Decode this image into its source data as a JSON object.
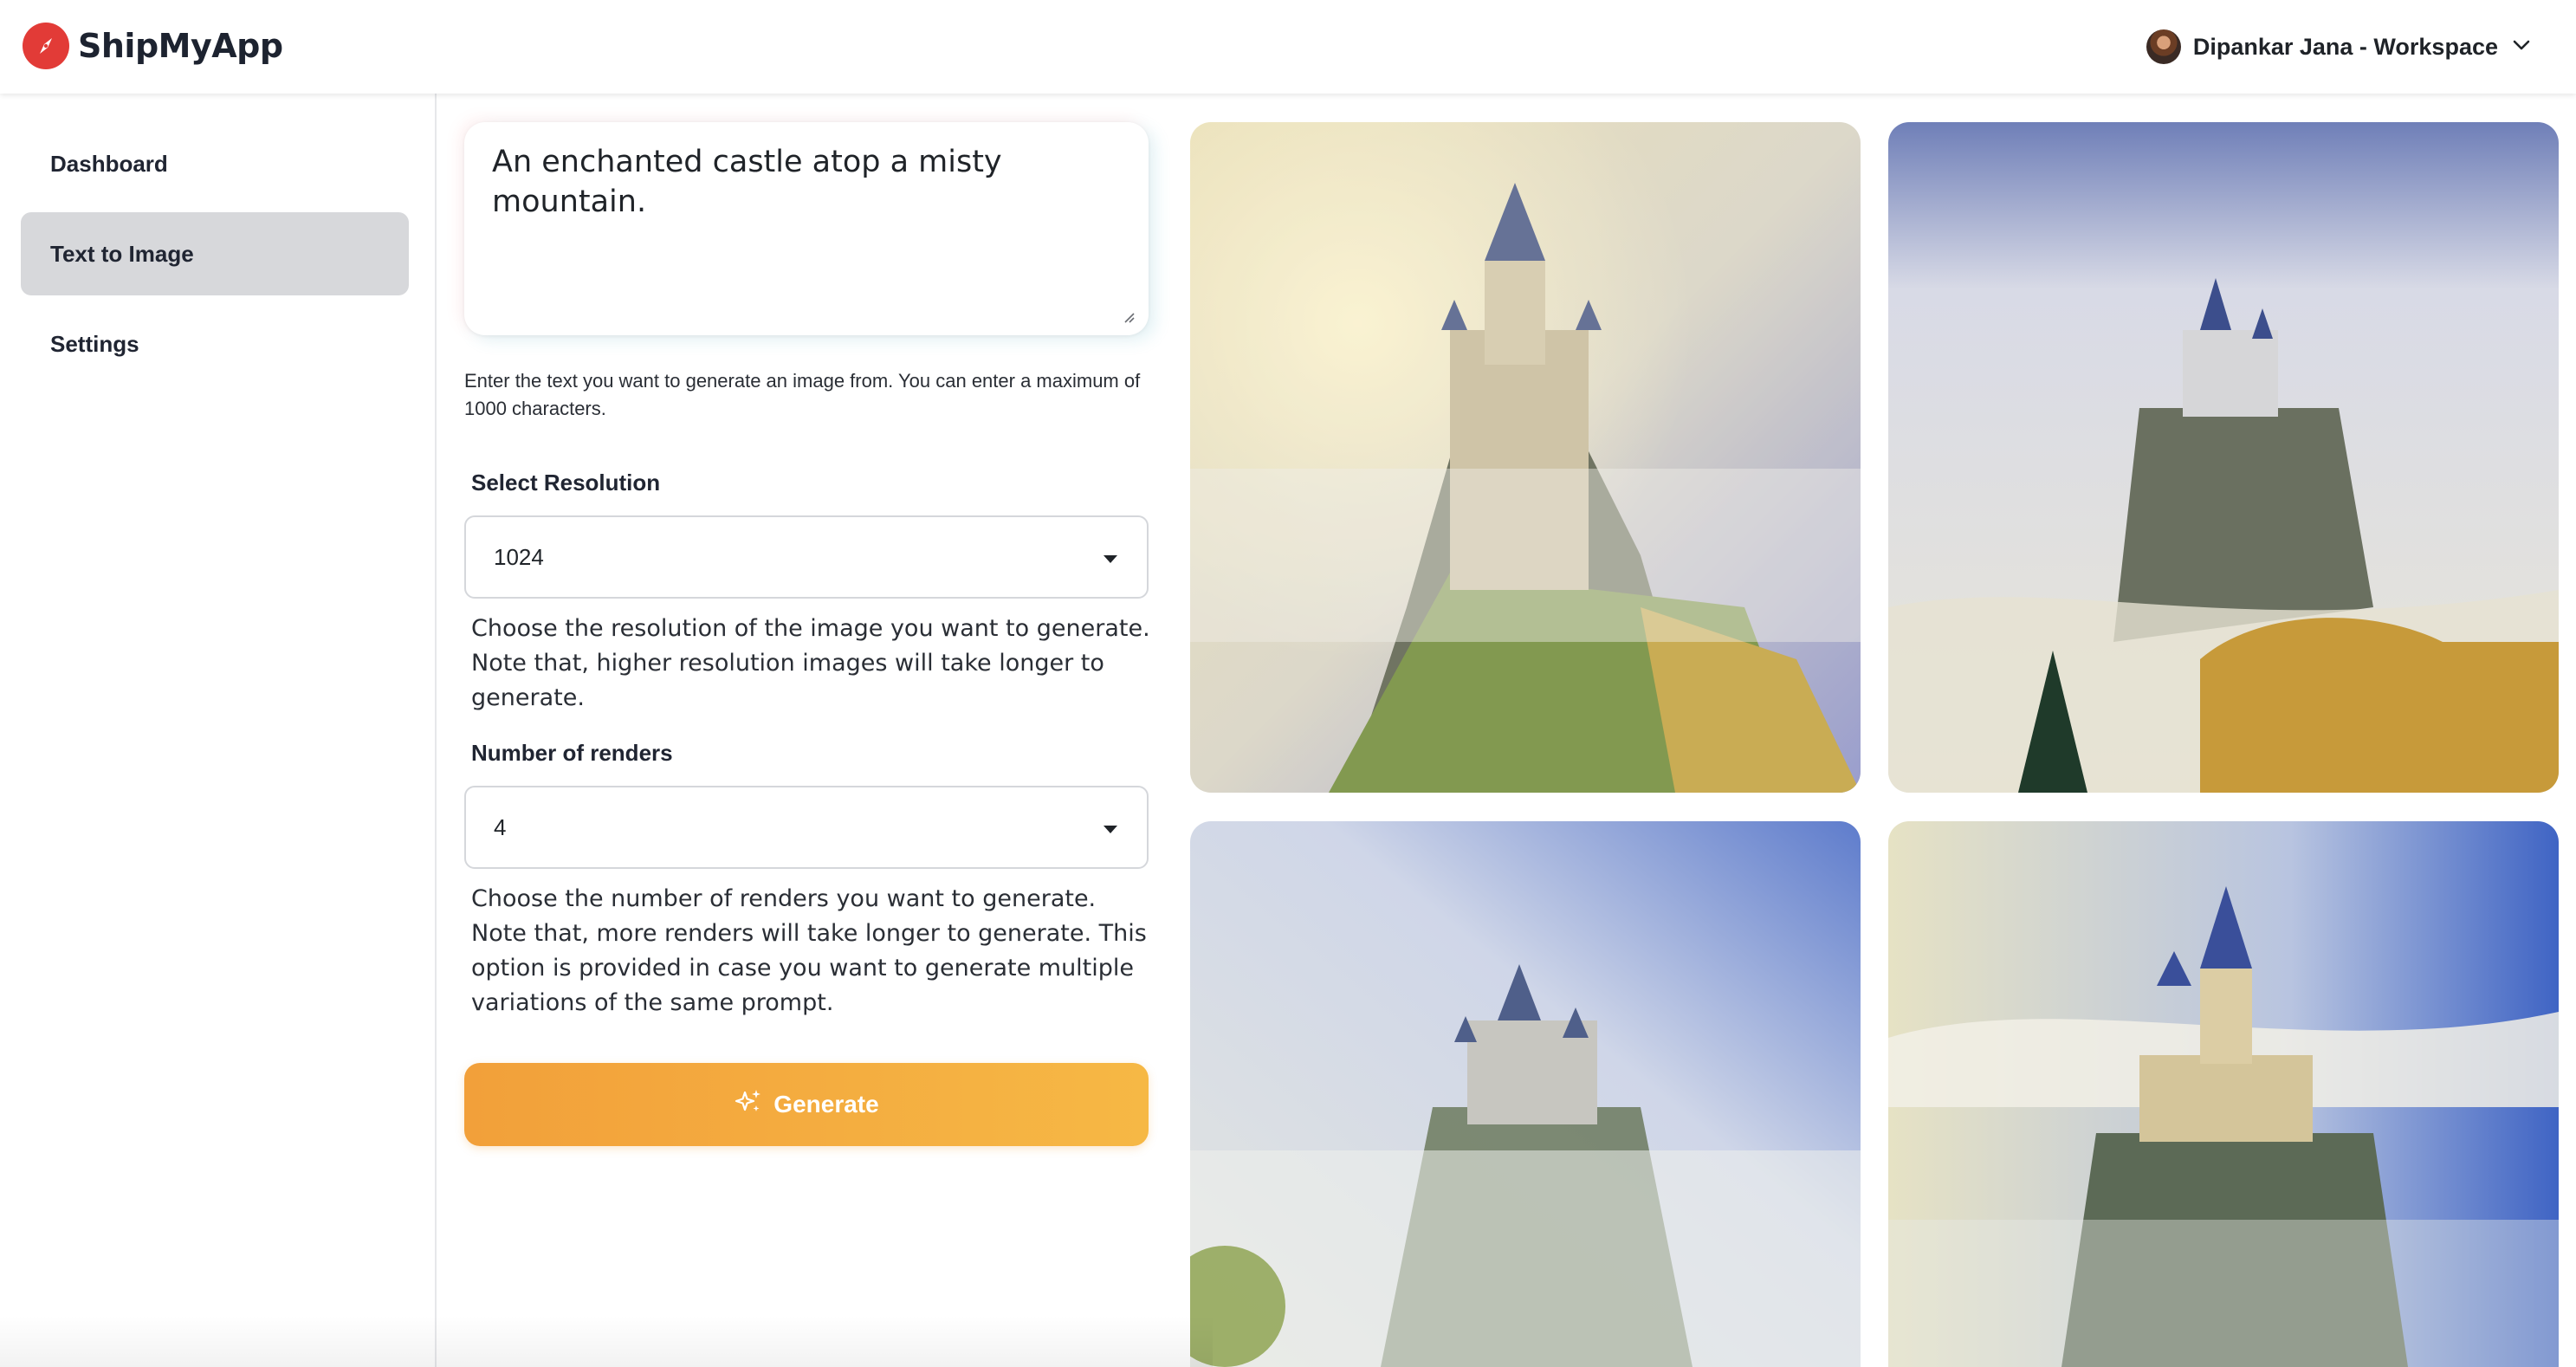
{
  "app": {
    "name": "ShipMyApp",
    "logo_icon": "compass-icon",
    "brand_color": "#e23b37"
  },
  "header": {
    "account_label": "Dipankar Jana - Workspace",
    "account_menu_icon": "chevron-down-icon"
  },
  "sidebar": {
    "items": [
      {
        "label": "Dashboard",
        "active": false
      },
      {
        "label": "Text to Image",
        "active": true
      },
      {
        "label": "Settings",
        "active": false
      }
    ]
  },
  "form": {
    "prompt": {
      "value": "An enchanted castle atop a misty mountain.",
      "helper": "Enter the text you want to generate an image from. You can enter a maximum of 1000 characters."
    },
    "resolution": {
      "label": "Select Resolution",
      "value": "1024",
      "helper": "Choose the resolution of the image you want to generate. Note that, higher resolution images will take longer to generate."
    },
    "renders": {
      "label": "Number of renders",
      "value": "4",
      "helper": "Choose the number of renders you want to generate. Note that, more renders will take longer to generate. This option is provided in case you want to generate multiple variations of the same prompt."
    },
    "generate": {
      "label": "Generate",
      "icon": "sparkles-icon",
      "gradient": [
        "#f2a03a",
        "#f6b845"
      ]
    }
  },
  "results": {
    "count": 4,
    "subject": "castle-on-misty-mountain"
  }
}
